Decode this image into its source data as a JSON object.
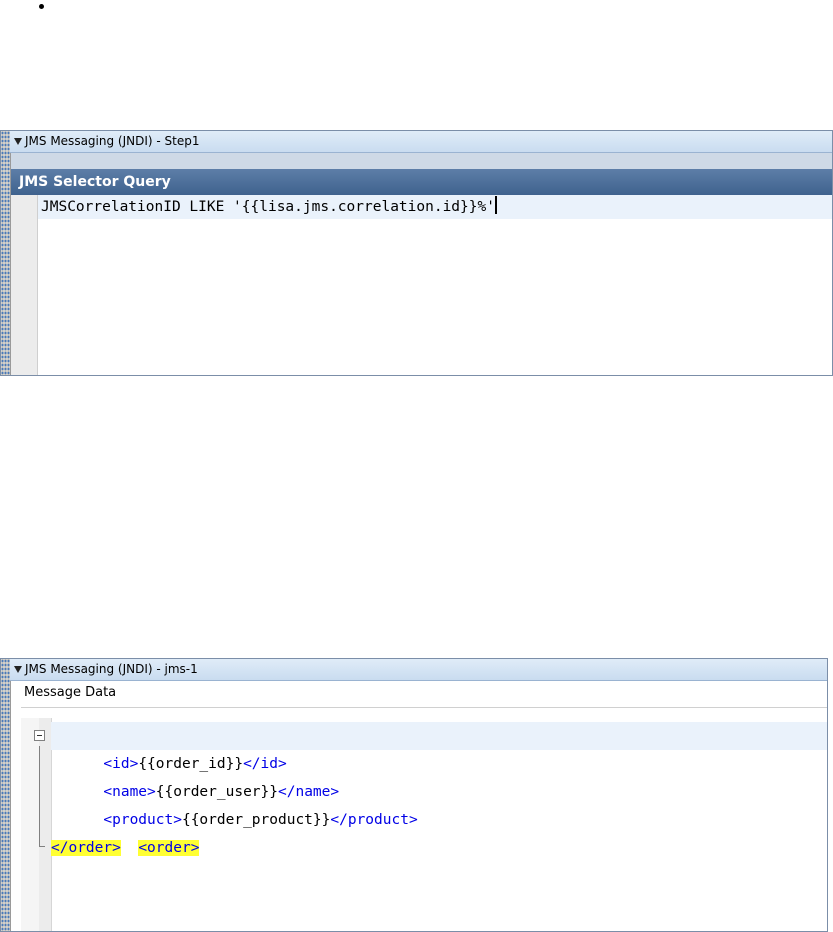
{
  "panel1": {
    "title": "JMS Messaging (JNDI) - Step1",
    "section_header": "JMS Selector Query",
    "query_text": "JMSCorrelationID LIKE '{{lisa.jms.correlation.id}}%'"
  },
  "panel2": {
    "title": "JMS Messaging (JNDI) - jms-1",
    "label": "Message Data",
    "xml": {
      "open_order": "<order>",
      "id_open": "<id>",
      "id_value": "{{order_id}}",
      "id_close": "</id>",
      "name_open": "<name>",
      "name_value": "{{order_user}}",
      "name_close": "</name>",
      "product_open": "<product>",
      "product_value": "{{order_product}}",
      "product_close": "</product>",
      "close_order": "</order>"
    }
  },
  "colors": {
    "header_blue": "#4a6d9a",
    "tag_blue": "#0000e6",
    "highlight_yellow": "#ffff33",
    "current_line": "#eaf2fb"
  },
  "icons": [
    "collapse-triangle-icon",
    "fold-minus-icon"
  ]
}
